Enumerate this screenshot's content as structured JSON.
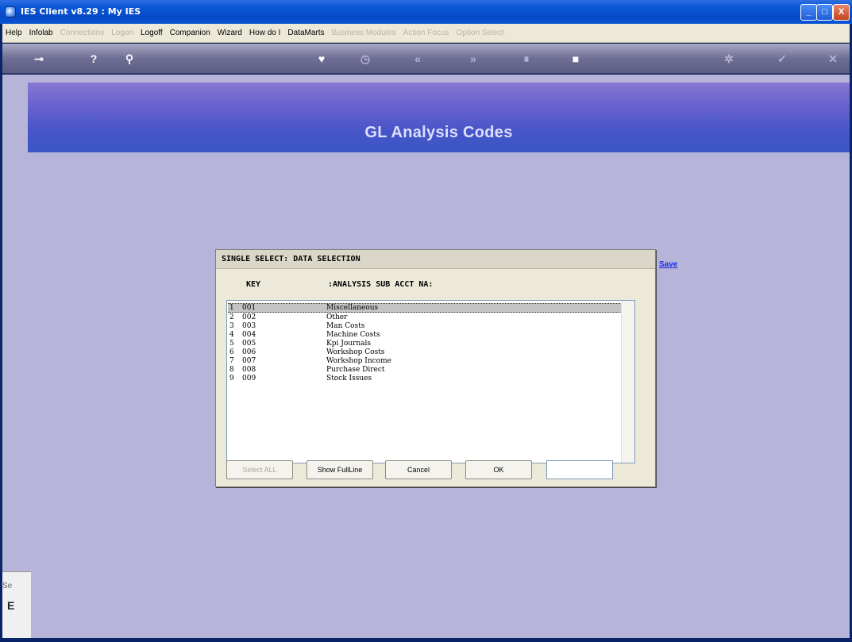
{
  "window": {
    "title": "IES Client v8.29 : My IES",
    "min_glyph": "_",
    "max_glyph": "□",
    "close_glyph": "X"
  },
  "menu": [
    {
      "label": "Help",
      "enabled": true
    },
    {
      "label": "Infolab",
      "enabled": true
    },
    {
      "label": "Connections",
      "enabled": false
    },
    {
      "label": "Logon",
      "enabled": false
    },
    {
      "label": "Logoff",
      "enabled": true
    },
    {
      "label": "Companion",
      "enabled": true
    },
    {
      "label": "Wizard",
      "enabled": true
    },
    {
      "label": "How do I",
      "enabled": true
    },
    {
      "label": "DataMarts",
      "enabled": true
    },
    {
      "label": "Business Modules",
      "enabled": false
    },
    {
      "label": "Action Focus",
      "enabled": false
    },
    {
      "label": "Option Select",
      "enabled": false
    }
  ],
  "toolbar": {
    "icons": [
      "key-icon",
      "help-icon",
      "search-icon",
      "heart-icon",
      "clock-icon",
      "rewind-icon",
      "forward-icon",
      "pause-icon",
      "stop-icon",
      "settings-icon",
      "check-icon",
      "close-icon"
    ],
    "glyphs": {
      "key": "⊸",
      "help": "?",
      "search": "⚲",
      "heart": "♥",
      "clock": "◷",
      "rewind": "«",
      "forward": "»",
      "pause": "⏸",
      "stop": "■",
      "settings": "✲",
      "check": "✓",
      "close": "✕"
    }
  },
  "banner": {
    "title": "GL Analysis Codes"
  },
  "save_link": "Save",
  "side": {
    "label1": "Se",
    "label2": "E"
  },
  "dialog": {
    "title": "SINGLE SELECT: DATA SELECTION",
    "col_key": "KEY",
    "col_name": ":ANALYSIS SUB ACCT NA:",
    "rows": [
      {
        "num": "1",
        "key": "001",
        "name": "Miscellaneous",
        "selected": true
      },
      {
        "num": "2",
        "key": "002",
        "name": "Other"
      },
      {
        "num": "3",
        "key": "003",
        "name": "Man Costs"
      },
      {
        "num": "4",
        "key": "004",
        "name": "Machine Costs"
      },
      {
        "num": "5",
        "key": "005",
        "name": "Kpi Journals"
      },
      {
        "num": "6",
        "key": "006",
        "name": "Workshop Costs"
      },
      {
        "num": "7",
        "key": "007",
        "name": "Workshop Income"
      },
      {
        "num": "8",
        "key": "008",
        "name": "Purchase Direct"
      },
      {
        "num": "9",
        "key": "009",
        "name": "Stock Issues"
      }
    ],
    "buttons": {
      "select_all": "Select ALL",
      "show_full_line": "Show FullLine",
      "cancel": "Cancel",
      "ok": "OK"
    },
    "input_value": ""
  }
}
